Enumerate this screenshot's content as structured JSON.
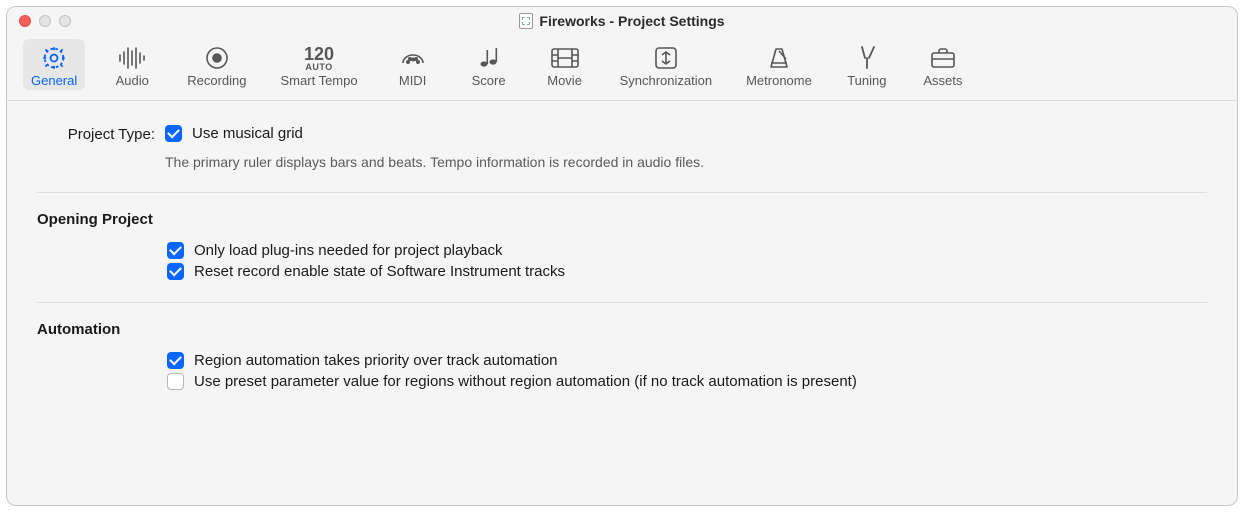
{
  "window": {
    "title": "Fireworks - Project Settings"
  },
  "tabs": {
    "general": "General",
    "audio": "Audio",
    "recording": "Recording",
    "smart_tempo_num": "120",
    "smart_tempo_sub": "AUTO",
    "smart_tempo": "Smart Tempo",
    "midi": "MIDI",
    "score": "Score",
    "movie": "Movie",
    "sync": "Synchronization",
    "metronome": "Metronome",
    "tuning": "Tuning",
    "assets": "Assets"
  },
  "project_type": {
    "label": "Project Type:",
    "option": "Use musical grid",
    "helper": "The primary ruler displays bars and beats. Tempo information is recorded in audio files."
  },
  "opening": {
    "title": "Opening Project",
    "opt1": "Only load plug-ins needed for project playback",
    "opt2": "Reset record enable state of Software Instrument tracks"
  },
  "automation": {
    "title": "Automation",
    "opt1": "Region automation takes priority over track automation",
    "opt2": "Use preset parameter value for regions without region automation (if no track automation is present)"
  }
}
